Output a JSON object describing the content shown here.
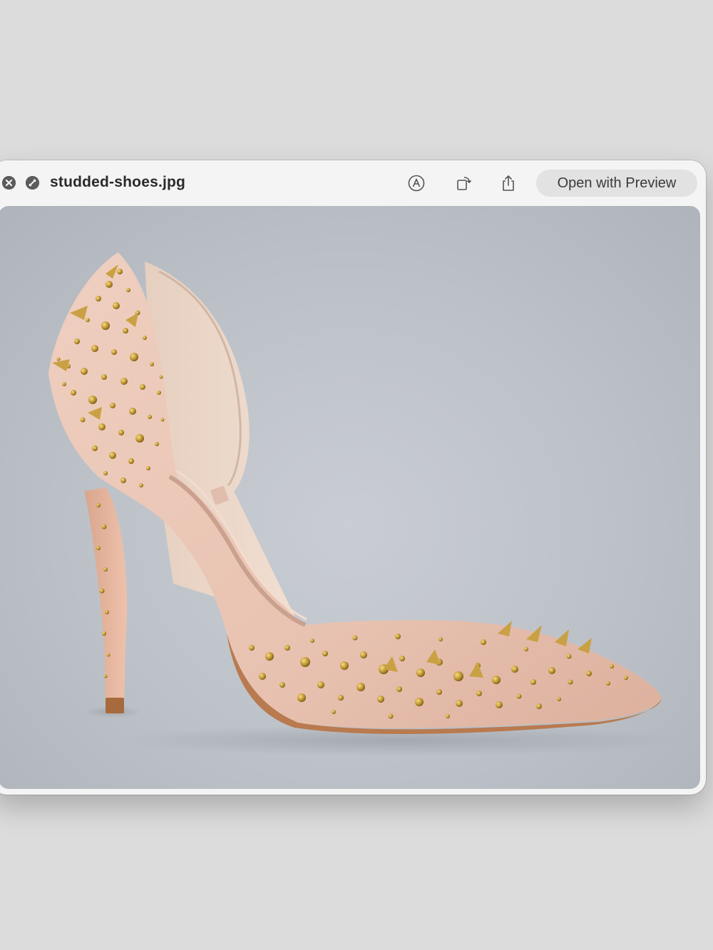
{
  "window": {
    "title": "studded-shoes.jpg",
    "open_button_label": "Open with Preview"
  },
  "icons": {
    "close": "close-icon",
    "fullscreen": "fullscreen-icon",
    "markup": "markup-icon",
    "rotate": "rotate-icon",
    "share": "share-icon"
  },
  "image": {
    "subject": "pink-suede-studded-stiletto-pump",
    "colors": {
      "background": "#bcc1c8",
      "suede": "#ecc7b7",
      "lining": "#e8d4c4",
      "studs": "#b8902e"
    }
  }
}
